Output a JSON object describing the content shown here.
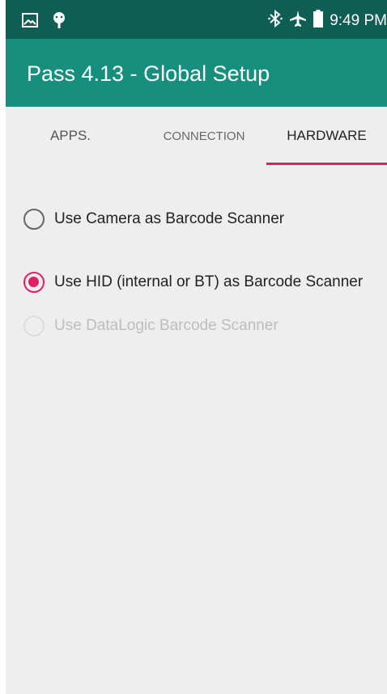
{
  "status_bar": {
    "left_icons": [
      "image-notification-icon",
      "android-icon"
    ],
    "right_icons": [
      "bluetooth-icon",
      "airplane-icon",
      "battery-icon"
    ],
    "time": "9:49 PM"
  },
  "app_bar": {
    "title": "Pass 4.13 - Global Setup"
  },
  "tabs": [
    {
      "label": "APPS.",
      "selected": false
    },
    {
      "label": "CONNECTION",
      "selected": false
    },
    {
      "label": "HARDWARE",
      "selected": true
    }
  ],
  "scanner_options": [
    {
      "label": "Use Camera as Barcode Scanner",
      "checked": false,
      "enabled": true
    },
    {
      "label": "Use HID (internal or BT) as Barcode Scanner",
      "checked": true,
      "enabled": true
    },
    {
      "label": "Use DataLogic Barcode Scanner",
      "checked": false,
      "enabled": false
    }
  ],
  "colors": {
    "status_bar": "#0f5e54",
    "app_bar": "#178f7e",
    "accent": "#e31f64",
    "background": "#eeeeee"
  }
}
